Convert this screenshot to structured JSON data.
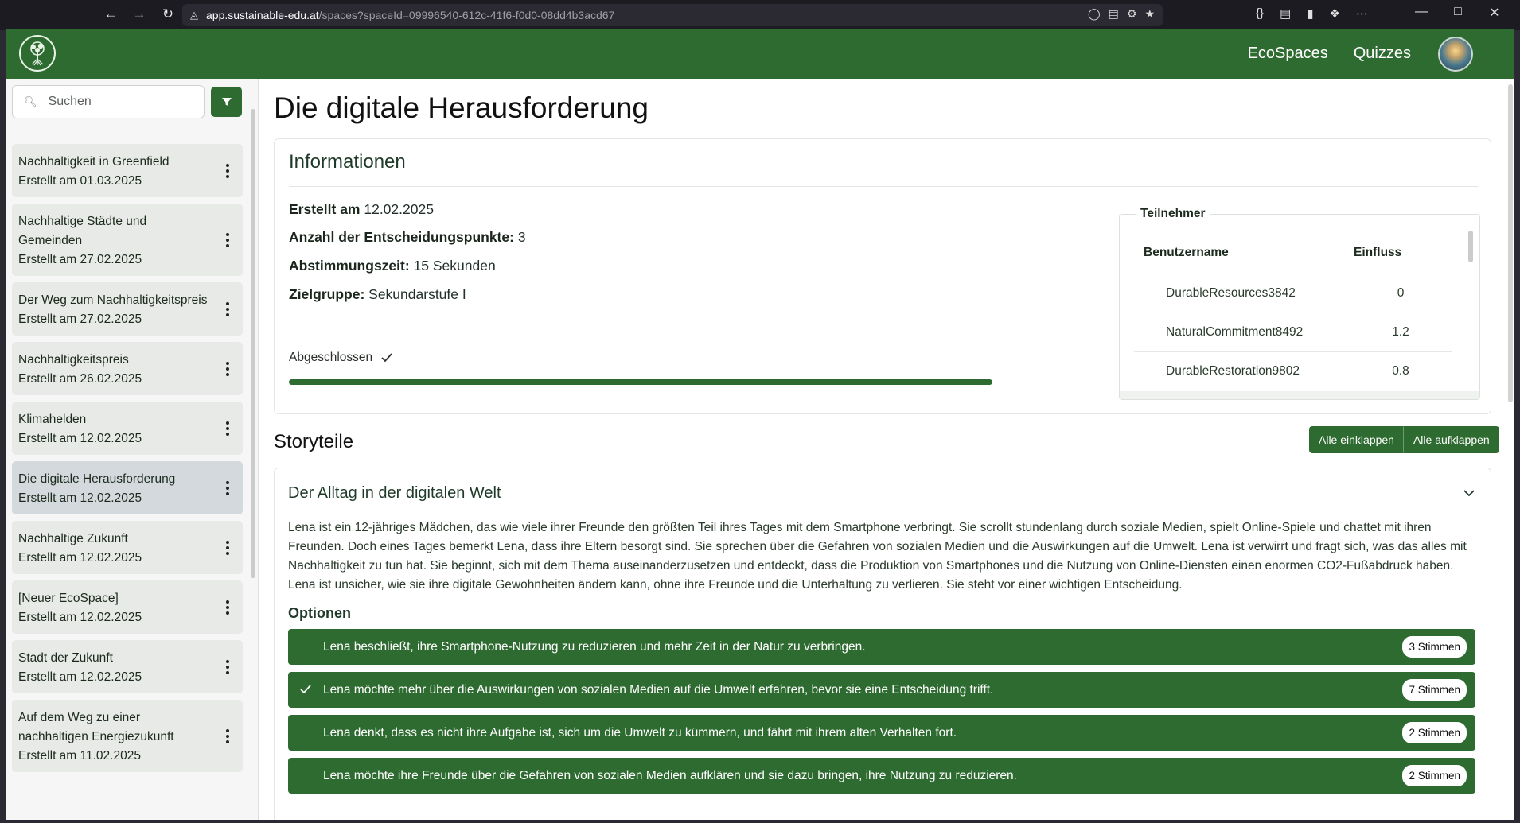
{
  "browser": {
    "url_host": "app.sustainable-edu.at",
    "url_path": "/spaces?spaceId=09996540-612c-41f6-f0d0-08dd4b3acd67"
  },
  "nav": {
    "ecospaces": "EcoSpaces",
    "quizzes": "Quizzes"
  },
  "sidebar": {
    "search_placeholder": "Suchen",
    "items": [
      {
        "name": "Nachhaltigkeit in Greenfield",
        "date": "Erstellt am 01.03.2025"
      },
      {
        "name": "Nachhaltige Städte und Gemeinden",
        "date": "Erstellt am 27.02.2025"
      },
      {
        "name": "Der Weg zum Nachhaltigkeitspreis",
        "date": "Erstellt am 27.02.2025"
      },
      {
        "name": "Nachhaltigkeitspreis",
        "date": "Erstellt am 26.02.2025"
      },
      {
        "name": "Klimahelden",
        "date": "Erstellt am 12.02.2025"
      },
      {
        "name": "Die digitale Herausforderung",
        "date": "Erstellt am 12.02.2025"
      },
      {
        "name": "Nachhaltige Zukunft",
        "date": "Erstellt am 12.02.2025"
      },
      {
        "name": "[Neuer EcoSpace]",
        "date": "Erstellt am 12.02.2025"
      },
      {
        "name": "Stadt der Zukunft",
        "date": "Erstellt am 12.02.2025"
      },
      {
        "name": "Auf dem Weg zu einer nachhaltigen Energiezukunft",
        "date": "Erstellt am 11.02.2025"
      }
    ]
  },
  "main": {
    "title": "Die digitale Herausforderung",
    "info": {
      "heading": "Informationen",
      "created_label": "Erstellt am",
      "created_value": "12.02.2025",
      "decisions_label": "Anzahl der Entscheidungspunkte:",
      "decisions_value": "3",
      "voting_label": "Abstimmungszeit:",
      "voting_value": "15 Sekunden",
      "target_label": "Zielgruppe:",
      "target_value": "Sekundarstufe I",
      "status": "Abgeschlossen",
      "progress": 1.0
    },
    "participants": {
      "legend": "Teilnehmer",
      "col_user": "Benutzername",
      "col_influence": "Einfluss",
      "rows": [
        {
          "user": "DurableResources3842",
          "influence": "0"
        },
        {
          "user": "NaturalCommitment8492",
          "influence": "1.2"
        },
        {
          "user": "DurableRestoration9802",
          "influence": "0.8"
        }
      ]
    },
    "story": {
      "heading": "Storyteile",
      "collapse_all": "Alle einklappen",
      "expand_all": "Alle aufklappen",
      "part_title": "Der Alltag in der digitalen Welt",
      "part_text": "Lena ist ein 12-jähriges Mädchen, das wie viele ihrer Freunde den größten Teil ihres Tages mit dem Smartphone verbringt. Sie scrollt stundenlang durch soziale Medien, spielt Online-Spiele und chattet mit ihren Freunden. Doch eines Tages bemerkt Lena, dass ihre Eltern besorgt sind. Sie sprechen über die Gefahren von sozialen Medien und die Auswirkungen auf die Umwelt. Lena ist verwirrt und fragt sich, was das alles mit Nachhaltigkeit zu tun hat. Sie beginnt, sich mit dem Thema auseinanderzusetzen und entdeckt, dass die Produktion von Smartphones und die Nutzung von Online-Diensten einen enormen CO2-Fußabdruck haben. Lena ist unsicher, wie sie ihre digitale Gewohnheiten ändern kann, ohne ihre Freunde und die Unterhaltung zu verlieren. Sie steht vor einer wichtigen Entscheidung.",
      "options_heading": "Optionen",
      "options": [
        {
          "text": "Lena beschließt, ihre Smartphone-Nutzung zu reduzieren und mehr Zeit in der Natur zu verbringen.",
          "votes": "3 Stimmen",
          "chosen": false
        },
        {
          "text": "Lena möchte mehr über die Auswirkungen von sozialen Medien auf die Umwelt erfahren, bevor sie eine Entscheidung trifft.",
          "votes": "7 Stimmen",
          "chosen": true
        },
        {
          "text": "Lena denkt, dass es nicht ihre Aufgabe ist, sich um die Umwelt zu kümmern, und fährt mit ihrem alten Verhalten fort.",
          "votes": "2 Stimmen",
          "chosen": false
        },
        {
          "text": "Lena möchte ihre Freunde über die Gefahren von sozialen Medien aufklären und sie dazu bringen, ihre Nutzung zu reduzieren.",
          "votes": "2 Stimmen",
          "chosen": false
        }
      ]
    }
  },
  "colors": {
    "brand_green": "#2e6b30",
    "active_item": "#d3d9dd"
  },
  "icons": [
    "back-icon",
    "forward-icon",
    "reload-icon",
    "lock-icon",
    "search-icon",
    "filter-icon",
    "kebab-icon",
    "check-icon",
    "chevron-down-icon",
    "tree-logo-icon"
  ]
}
